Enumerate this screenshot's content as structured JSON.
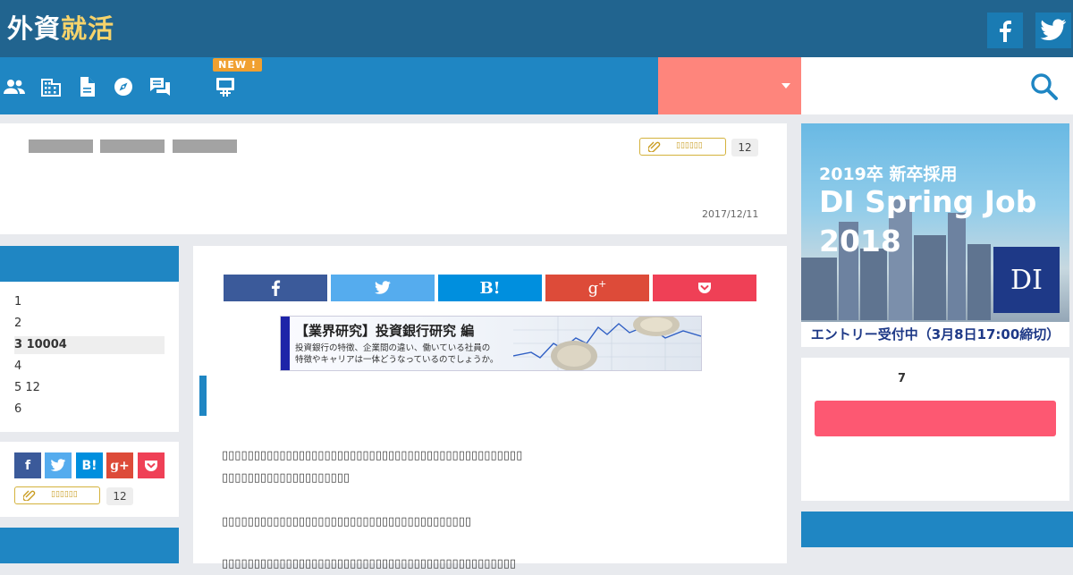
{
  "header": {
    "logo_part1": "外資",
    "logo_part2": "就活",
    "social": [
      "facebook-icon",
      "twitter-icon"
    ]
  },
  "nav": {
    "icons": [
      "people-icon",
      "building-icon",
      "document-icon",
      "compass-icon",
      "chat-icon",
      "board-icon"
    ],
    "new_badge": "NEW !",
    "dropdown_icon": "caret-down-icon",
    "search_icon": "search-icon"
  },
  "article": {
    "tag_count": "12",
    "date": "2017/12/11"
  },
  "toc": {
    "items": [
      {
        "label": "1",
        "active": false
      },
      {
        "label": "2",
        "active": false
      },
      {
        "label": "3 10004",
        "active": true
      },
      {
        "label": "4",
        "active": false
      },
      {
        "label": "5 12",
        "active": false
      },
      {
        "label": "6",
        "active": false
      }
    ],
    "share_labels": [
      "f",
      "t",
      "B!",
      "g+",
      "pocket"
    ],
    "tag_count": "12"
  },
  "share_bar": {
    "buttons": [
      {
        "name": "facebook",
        "label": "f",
        "color": "#3b5a9a"
      },
      {
        "name": "twitter",
        "label": "t",
        "color": "#55acee"
      },
      {
        "name": "hatena",
        "label": "B!",
        "color": "#008fde"
      },
      {
        "name": "googleplus",
        "label": "g+",
        "color": "#dd4b39"
      },
      {
        "name": "pocket",
        "label": "pocket",
        "color": "#ef4056"
      }
    ]
  },
  "banner": {
    "title": "【業界研究】投資銀行研究 編",
    "line1": "投資銀行の特徴、企業間の違い、働いている社員の",
    "line2": "特徴やキャリアは一体どうなっているのでしょうか。"
  },
  "ad": {
    "line1": "2019卒 新卒採用",
    "line2": "DI Spring Job 2018",
    "logo": "DI",
    "footer": "エントリー受付中（3月8日17:00締切）"
  },
  "ranking": {
    "number": "7"
  }
}
